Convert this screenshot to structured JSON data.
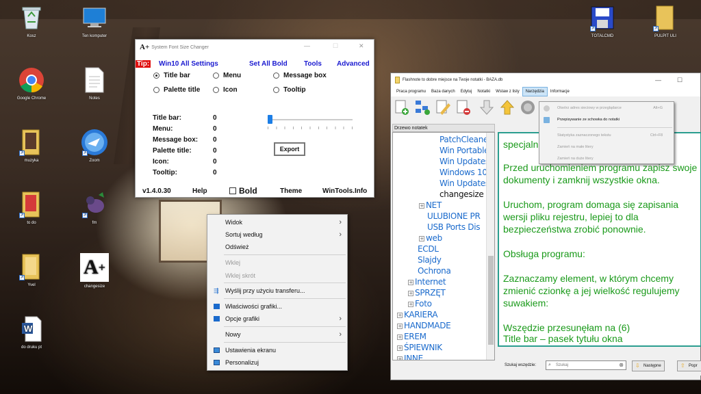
{
  "desktop": {
    "icons": [
      {
        "label": "Kosz",
        "icon": "recycle-bin-icon"
      },
      {
        "label": "Ten komputer",
        "icon": "this-pc-icon"
      },
      {
        "label": "Google Chrome",
        "icon": "chrome-icon"
      },
      {
        "label": "Notes",
        "icon": "notepad-file-icon"
      },
      {
        "label": "muzyka",
        "icon": "folder-icon"
      },
      {
        "label": "Zoom",
        "icon": "zoom-icon"
      },
      {
        "label": "to do",
        "icon": "folder-icon"
      },
      {
        "label": "fm",
        "icon": "fm-icon"
      },
      {
        "label": "Yvel",
        "icon": "folder-icon"
      },
      {
        "label": "changesize",
        "icon": "changesize-icon"
      },
      {
        "label": "do druku pt",
        "icon": "word-doc-icon"
      },
      {
        "label": "TOTALCMD",
        "icon": "floppy-icon"
      },
      {
        "label": "PULPIT ULI",
        "icon": "folder-icon"
      }
    ]
  },
  "sfsc": {
    "title": "System Font Size Changer",
    "logo": "A+",
    "tip": "Tip:",
    "win10": "Win10 All Settings",
    "set_all_bold": "Set All Bold",
    "tools": "Tools",
    "advanced": "Advanced",
    "options": {
      "title_bar": "Title bar",
      "menu": "Menu",
      "message_box": "Message box",
      "palette_title": "Palette title",
      "icon": "Icon",
      "tooltip": "Tooltip"
    },
    "selected_option": "Title bar",
    "values": [
      {
        "label": "Title bar:",
        "value": "0"
      },
      {
        "label": "Menu:",
        "value": "0"
      },
      {
        "label": "Message box:",
        "value": "0"
      },
      {
        "label": "Palette title:",
        "value": "0"
      },
      {
        "label": "Icon:",
        "value": "0"
      },
      {
        "label": "Tooltip:",
        "value": "0"
      }
    ],
    "slider_level": 0,
    "export": "Export",
    "version": "v1.4.0.30",
    "help": "Help",
    "bold": "Bold",
    "theme": "Theme",
    "wintools": "WinTools.Info"
  },
  "context_menu": {
    "items": [
      {
        "label": "Widok",
        "submenu": true,
        "enabled": true
      },
      {
        "label": "Sortuj według",
        "submenu": true,
        "enabled": true
      },
      {
        "label": "Odśwież",
        "enabled": true
      },
      {
        "label": "Wklej",
        "enabled": false
      },
      {
        "label": "Wklej skrót",
        "enabled": false
      },
      {
        "label": "Wyślij przy użyciu transferu...",
        "enabled": true,
        "icon": "transfer-icon"
      },
      {
        "label": "Właściwości grafiki...",
        "enabled": true,
        "icon": "intel-graphics-icon"
      },
      {
        "label": "Opcje grafiki",
        "submenu": true,
        "enabled": true,
        "icon": "intel-graphics-icon"
      },
      {
        "label": "Nowy",
        "submenu": true,
        "enabled": true
      },
      {
        "label": "Ustawienia ekranu",
        "enabled": true,
        "icon": "display-icon"
      },
      {
        "label": "Personalizuj",
        "enabled": true,
        "icon": "personalize-icon"
      }
    ]
  },
  "flashnote": {
    "title": "Flashnote to dobre miejsce na Twoje notatki - BAZA.db",
    "menu": [
      "Praca programu",
      "Baza danych",
      "Edytuj",
      "Notatki",
      "Wstaw z listy",
      "Narzędzia",
      "Informacje"
    ],
    "active_menu": "Narzędzia",
    "tree_header": "Drzewo notatek",
    "tree": [
      {
        "label": "PatchCleane",
        "level": 3
      },
      {
        "label": "Win Portable",
        "level": 3
      },
      {
        "label": "Win Updates",
        "level": 3
      },
      {
        "label": "Windows 10",
        "level": 3
      },
      {
        "label": "Win Updates",
        "level": 3
      },
      {
        "label": "changesize",
        "level": 3,
        "selected": true
      },
      {
        "label": "NET",
        "level": 2,
        "expand": true
      },
      {
        "label": "ULUBIONE PR",
        "level": 2
      },
      {
        "label": "USB Ports Dis",
        "level": 2
      },
      {
        "label": "web",
        "level": 2,
        "expand": true
      },
      {
        "label": "ECDL",
        "level": 1
      },
      {
        "label": "Slajdy",
        "level": 1
      },
      {
        "label": "Ochrona",
        "level": 1
      },
      {
        "label": "Internet",
        "level": 1,
        "expand": true
      },
      {
        "label": "SPRZĘT",
        "level": 1,
        "expand": true
      },
      {
        "label": "Foto",
        "level": 1,
        "expand": true
      },
      {
        "label": "KARIERA",
        "level": 0,
        "expand": true
      },
      {
        "label": "HANDMADE",
        "level": 0,
        "expand": true
      },
      {
        "label": "EREM",
        "level": 0,
        "expand": true
      },
      {
        "label": "ŚPIEWNIK",
        "level": 0,
        "expand": true
      },
      {
        "label": "INNE",
        "level": 0,
        "expand": true
      }
    ],
    "editor_lines": [
      "specjalnie",
      "",
      "Przed uruchomieniem programu zapisz swoje",
      "dokumenty i zamknij wszystkie okna.",
      "",
      "Uruchom, program domaga się zapisania",
      "wersji pliku rejestru, lepiej to dla",
      "bezpieczeństwa zrobić ponownie.",
      "",
      "Obsługa programu:",
      "",
      "Zaznaczamy element, w którym chcemy",
      "zmienić czionkę a jej wielkość regulujemy",
      "suwakiem:",
      "",
      "Wszędzie przesunęłam na (6)",
      "Title bar – pasek tytułu okna"
    ],
    "search_label": "Szukaj wszędzie:",
    "search_placeholder": "Szukaj",
    "next_button": "Następne",
    "prev_button": "Popr",
    "dropdown": [
      {
        "label": "Otwórz adres sieciowy w przeglądarce",
        "shortcut": "Alt+G",
        "enabled": false
      },
      {
        "label": "Przepisywanie ze schowka do notatki",
        "shortcut": "",
        "enabled": true
      },
      {
        "label": "Statystyka zaznaczonego tekstu",
        "shortcut": "Ctrl+F8",
        "enabled": false
      },
      {
        "label": "Zamień na małe litery",
        "shortcut": "",
        "enabled": false
      },
      {
        "label": "Zamień na duże litery",
        "shortcut": "",
        "enabled": false
      }
    ]
  }
}
